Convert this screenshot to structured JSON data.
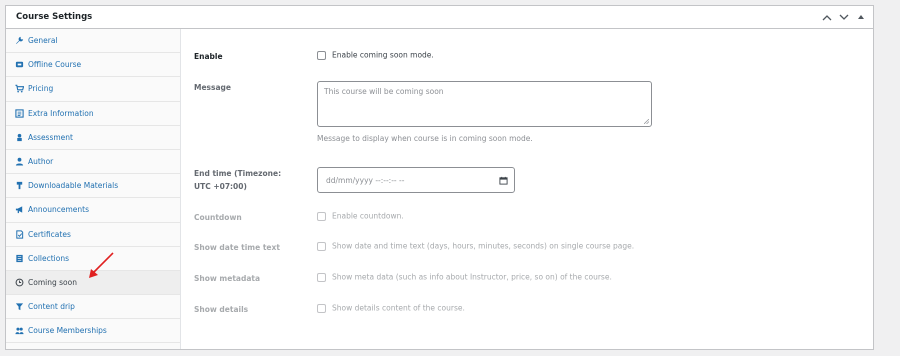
{
  "panel": {
    "title": "Course Settings"
  },
  "sidebar": {
    "items": [
      {
        "label": "General",
        "icon": "wrench-icon"
      },
      {
        "label": "Offline Course",
        "icon": "offline-icon"
      },
      {
        "label": "Pricing",
        "icon": "cart-icon"
      },
      {
        "label": "Extra Information",
        "icon": "list-icon"
      },
      {
        "label": "Assessment",
        "icon": "assessment-icon"
      },
      {
        "label": "Author",
        "icon": "user-icon"
      },
      {
        "label": "Downloadable Materials",
        "icon": "download-icon"
      },
      {
        "label": "Announcements",
        "icon": "megaphone-icon"
      },
      {
        "label": "Certificates",
        "icon": "certificate-icon"
      },
      {
        "label": "Collections",
        "icon": "collection-icon"
      },
      {
        "label": "Coming soon",
        "icon": "clock-icon",
        "active": true
      },
      {
        "label": "Content drip",
        "icon": "filter-icon"
      },
      {
        "label": "Course Memberships",
        "icon": "membership-icon"
      }
    ]
  },
  "form": {
    "enable": {
      "label": "Enable",
      "checkbox_label": "Enable coming soon mode."
    },
    "message": {
      "label": "Message",
      "placeholder": "This course will be coming soon",
      "description": "Message to display when course is in coming soon mode."
    },
    "end_time": {
      "label": "End time (Timezone: UTC +07:00)",
      "placeholder": "dd/mm/yyyy --:--:-- --"
    },
    "countdown": {
      "label": "Countdown",
      "checkbox_label": "Enable countdown."
    },
    "show_date_time_text": {
      "label": "Show date time text",
      "checkbox_label": "Show date and time text (days, hours, minutes, seconds) on single course page."
    },
    "show_metadata": {
      "label": "Show metadata",
      "checkbox_label": "Show meta data (such as info about Instructor, price, so on) of the course."
    },
    "show_details": {
      "label": "Show details",
      "checkbox_label": "Show details content of the course."
    }
  },
  "colors": {
    "link": "#2271b1",
    "annotation_arrow": "#e02020",
    "border": "#c3c4c7"
  }
}
